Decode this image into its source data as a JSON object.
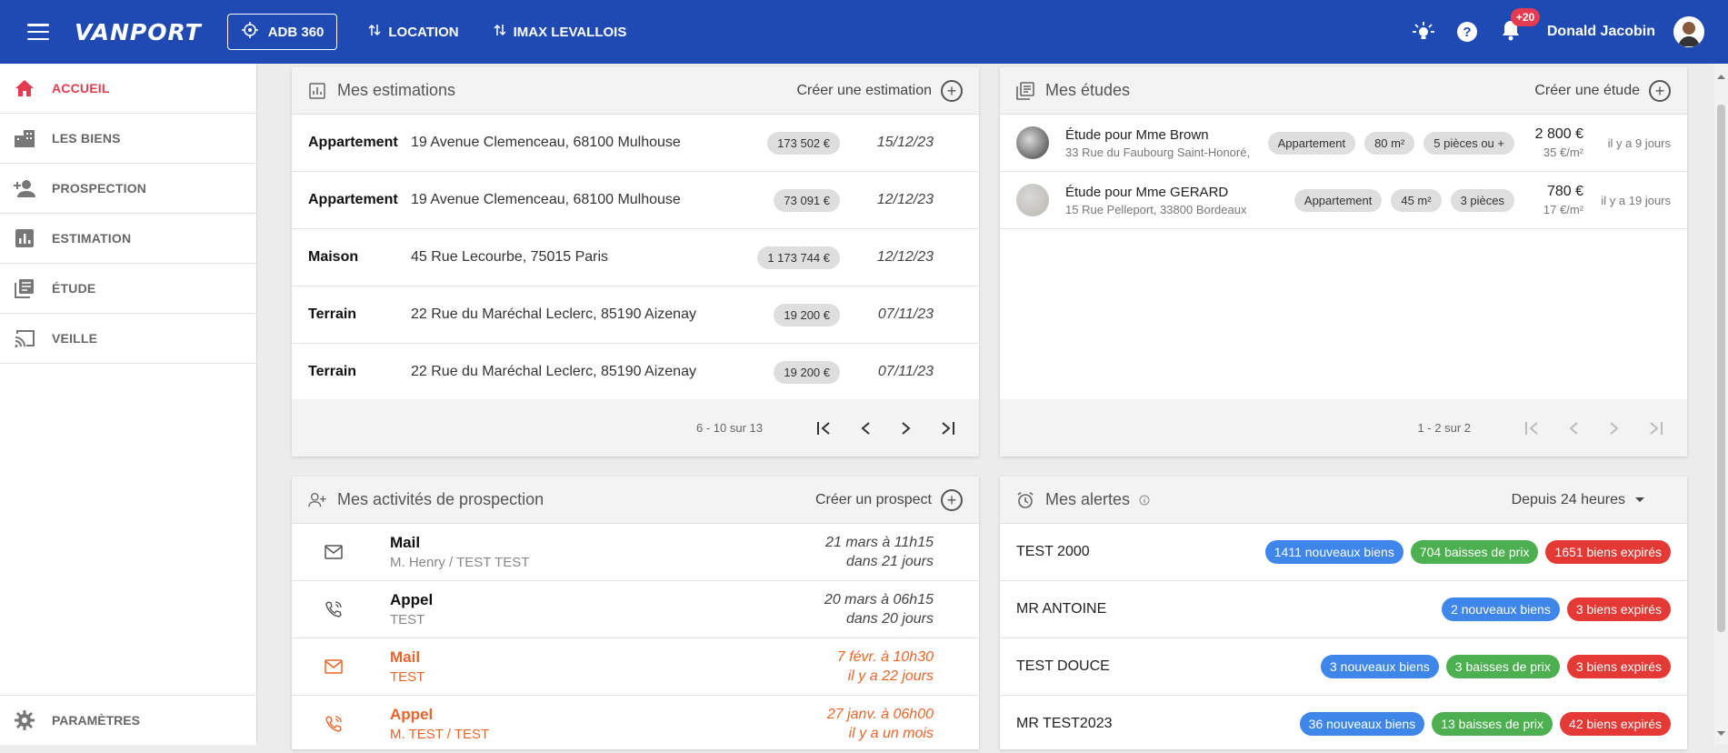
{
  "topbar": {
    "logo": "VANPORT",
    "adb_button": "ADB 360",
    "nav": [
      "LOCATION",
      "IMAX LEVALLOIS"
    ],
    "notif_count": "+20",
    "user_name": "Donald Jacobin"
  },
  "sidebar": {
    "items": [
      {
        "label": "ACCUEIL",
        "icon": "home-icon"
      },
      {
        "label": "LES BIENS",
        "icon": "buildings-icon"
      },
      {
        "label": "PROSPECTION",
        "icon": "person-add-icon"
      },
      {
        "label": "ESTIMATION",
        "icon": "bar-chart-icon"
      },
      {
        "label": "ÉTUDE",
        "icon": "library-icon"
      },
      {
        "label": "VEILLE",
        "icon": "cast-icon"
      }
    ],
    "params_label": "PARAMÈTRES"
  },
  "estimations": {
    "title": "Mes estimations",
    "action": "Créer une estimation",
    "rows": [
      {
        "type": "Appartement",
        "address": "19 Avenue Clemenceau, 68100 Mulhouse",
        "price": "173 502 €",
        "date": "15/12/23"
      },
      {
        "type": "Appartement",
        "address": "19 Avenue Clemenceau, 68100 Mulhouse",
        "price": "73 091 €",
        "date": "12/12/23"
      },
      {
        "type": "Maison",
        "address": "45 Rue Lecourbe, 75015 Paris",
        "price": "1 173 744 €",
        "date": "12/12/23"
      },
      {
        "type": "Terrain",
        "address": "22 Rue du Maréchal Leclerc, 85190 Aizenay",
        "price": "19 200 €",
        "date": "07/11/23"
      },
      {
        "type": "Terrain",
        "address": "22 Rue du Maréchal Leclerc, 85190 Aizenay",
        "price": "19 200 €",
        "date": "07/11/23"
      }
    ],
    "pagination": "6 - 10 sur 13"
  },
  "etudes": {
    "title": "Mes études",
    "action": "Créer une étude",
    "rows": [
      {
        "title": "Étude pour Mme Brown",
        "address": "33 Rue du Faubourg Saint-Honoré,",
        "chips": [
          "Appartement",
          "80 m²",
          "5 pièces ou +"
        ],
        "price": "2 800 €",
        "ppm": "35 €/m²",
        "ago": "il y a 9 jours"
      },
      {
        "title": "Étude pour Mme GERARD",
        "address": "15 Rue Pelleport, 33800 Bordeaux",
        "chips": [
          "Appartement",
          "45 m²",
          "3 pièces"
        ],
        "price": "780 €",
        "ppm": "17 €/m²",
        "ago": "il y a 19 jours"
      }
    ],
    "pagination": "1 - 2 sur 2"
  },
  "prospection": {
    "title": "Mes activités de prospection",
    "action": "Créer un prospect",
    "rows": [
      {
        "type": "Mail",
        "who": "M. Henry / TEST TEST",
        "date": "21 mars à 11h15",
        "rel": "dans 21 jours",
        "late": false,
        "icon": "mail-icon"
      },
      {
        "type": "Appel",
        "who": "TEST",
        "date": "20 mars à 06h15",
        "rel": "dans 20 jours",
        "late": false,
        "icon": "phone-call-icon"
      },
      {
        "type": "Mail",
        "who": "TEST",
        "date": "7 févr. à 10h30",
        "rel": "il y a 22 jours",
        "late": true,
        "icon": "mail-icon"
      },
      {
        "type": "Appel",
        "who": "M. TEST / TEST",
        "date": "27 janv. à 06h00",
        "rel": "il y a un mois",
        "late": true,
        "icon": "phone-call-icon"
      }
    ]
  },
  "alertes": {
    "title": "Mes alertes",
    "filter": "Depuis 24 heures",
    "colors": {
      "new": "#3f86ea",
      "drop": "#4caf50",
      "expired": "#e53935"
    },
    "rows": [
      {
        "name": "TEST 2000",
        "badges": [
          {
            "text": "1411 nouveaux biens",
            "kind": "new"
          },
          {
            "text": "704 baisses de prix",
            "kind": "drop"
          },
          {
            "text": "1651 biens expirés",
            "kind": "expired"
          }
        ]
      },
      {
        "name": "MR ANTOINE",
        "badges": [
          {
            "text": "2 nouveaux biens",
            "kind": "new"
          },
          {
            "text": "3 biens expirés",
            "kind": "expired"
          }
        ]
      },
      {
        "name": "TEST DOUCE",
        "badges": [
          {
            "text": "3 nouveaux biens",
            "kind": "new"
          },
          {
            "text": "3 baisses de prix",
            "kind": "drop"
          },
          {
            "text": "3 biens expirés",
            "kind": "expired"
          }
        ]
      },
      {
        "name": "MR TEST2023",
        "badges": [
          {
            "text": "36 nouveaux biens",
            "kind": "new"
          },
          {
            "text": "13 baisses de prix",
            "kind": "drop"
          },
          {
            "text": "42 biens expirés",
            "kind": "expired"
          }
        ]
      }
    ]
  }
}
